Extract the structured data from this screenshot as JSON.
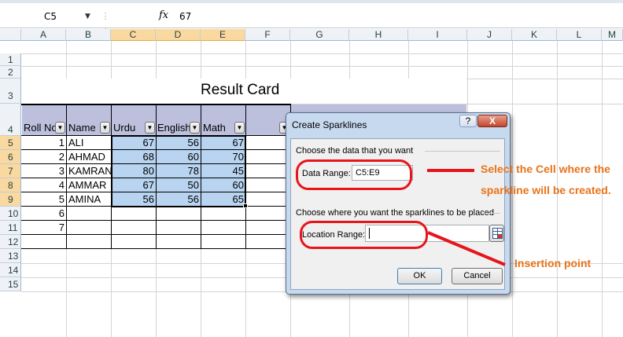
{
  "formula_bar": {
    "name_box": "C5",
    "fx": "fx",
    "value": "67"
  },
  "columns": [
    "A",
    "B",
    "C",
    "D",
    "E",
    "F",
    "G",
    "H",
    "I",
    "J",
    "K",
    "L",
    "M"
  ],
  "rows": [
    "1",
    "2",
    "3",
    "4",
    "5",
    "6",
    "7",
    "8",
    "9",
    "10",
    "11",
    "12",
    "13",
    "14",
    "15"
  ],
  "sheet": {
    "title": "Result Card",
    "headers": {
      "roll_no": "Roll No",
      "name": "Name",
      "urdu": "Urdu",
      "english": "English",
      "math": "Math"
    },
    "records": [
      {
        "roll": "1",
        "name": "ALI",
        "urdu": "67",
        "english": "56",
        "math": "67"
      },
      {
        "roll": "2",
        "name": "AHMAD",
        "urdu": "68",
        "english": "60",
        "math": "70"
      },
      {
        "roll": "3",
        "name": "KAMRAN",
        "urdu": "80",
        "english": "78",
        "math": "45"
      },
      {
        "roll": "4",
        "name": "AMMAR",
        "urdu": "67",
        "english": "50",
        "math": "60"
      },
      {
        "roll": "5",
        "name": "AMINA",
        "urdu": "56",
        "english": "56",
        "math": "65"
      },
      {
        "roll": "6",
        "name": "",
        "urdu": "",
        "english": "",
        "math": ""
      },
      {
        "roll": "7",
        "name": "",
        "urdu": "",
        "english": "",
        "math": ""
      }
    ]
  },
  "dialog": {
    "title": "Create Sparklines",
    "help": "?",
    "close": "X",
    "section1": "Choose the data that you want",
    "data_range_label": "Data Range:",
    "data_range_value": "C5:E9",
    "section2": "Choose where you want the sparklines to be placed",
    "location_range_label": "Location Range:",
    "location_range_value": "",
    "ok": "OK",
    "cancel": "Cancel"
  },
  "annotations": {
    "select_line1": "Select the Cell where the",
    "select_line2": "sparkline will be created.",
    "insertion": "Insertion point"
  },
  "colors": {
    "selection": "#b8d4f0",
    "header_fill": "#bcc0dd",
    "annotation_red": "#e8141b",
    "annotation_text": "#e8731a"
  }
}
